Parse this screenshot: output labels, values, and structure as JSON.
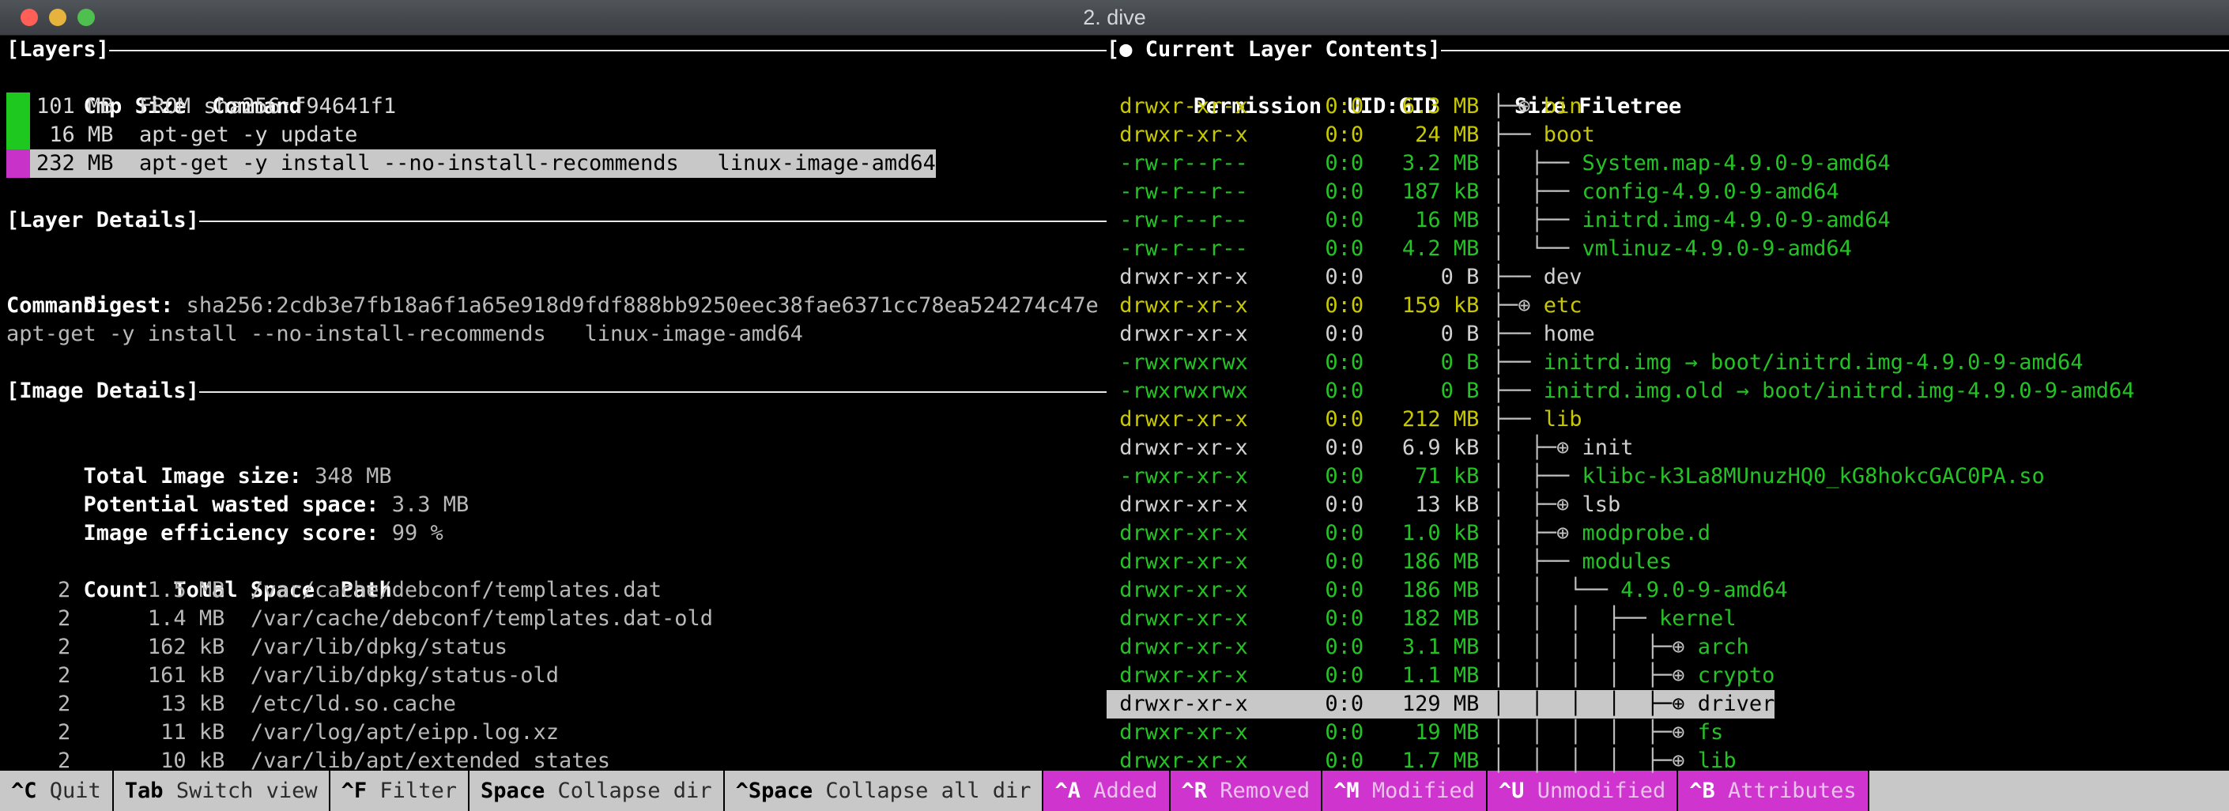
{
  "window": {
    "title": "2. dive",
    "controls": [
      "close-button",
      "minimize-button",
      "zoom-button"
    ]
  },
  "colors": {
    "added": "#25c225",
    "modified": "#c8c800",
    "unmodified": "#d0d0d0",
    "selection_bg": "#c8c8c8",
    "status_pink": "#cf34cf",
    "layer_swatch_green": "#1ec81e",
    "layer_swatch_magenta": "#c832c8",
    "terminal_bg": "#000000"
  },
  "left": {
    "layers_panel": {
      "title": "[Layers]",
      "columns": [
        "Cmp",
        "Size",
        "Command"
      ],
      "rows": [
        {
          "swatch": "green",
          "size": "101 MB",
          "command": "FROM sha256:f94641f1",
          "selected": false
        },
        {
          "swatch": "green",
          "size": " 16 MB",
          "command": "apt-get -y update",
          "selected": false
        },
        {
          "swatch": "magenta",
          "size": "232 MB",
          "command": "apt-get -y install --no-install-recommends   linux-image-amd64",
          "selected": true
        }
      ]
    },
    "layer_details_panel": {
      "title": "[Layer Details]",
      "digest_label": "Digest:",
      "digest_value": "sha256:2cdb3e7fb18a6f1a65e918d9fdf888bb9250eec38fae6371cc78ea524274c47e",
      "command_label": "Command:",
      "command_value": "apt-get -y install --no-install-recommends   linux-image-amd64"
    },
    "image_details_panel": {
      "title": "[Image Details]",
      "total_image_size_label": "Total Image size:",
      "total_image_size_value": "348 MB",
      "potential_wasted_space_label": "Potential wasted space:",
      "potential_wasted_space_value": "3.3 MB",
      "image_efficiency_score_label": "Image efficiency score:",
      "image_efficiency_score_value": "99 %",
      "columns": [
        "Count",
        "Total Space",
        "Path"
      ],
      "rows": [
        {
          "count": "2",
          "total_space": "1.5 MB",
          "path": "/var/cache/debconf/templates.dat"
        },
        {
          "count": "2",
          "total_space": "1.4 MB",
          "path": "/var/cache/debconf/templates.dat-old"
        },
        {
          "count": "2",
          "total_space": "162 kB",
          "path": "/var/lib/dpkg/status"
        },
        {
          "count": "2",
          "total_space": "161 kB",
          "path": "/var/lib/dpkg/status-old"
        },
        {
          "count": "2",
          "total_space": " 13 kB",
          "path": "/etc/ld.so.cache"
        },
        {
          "count": "2",
          "total_space": " 11 kB",
          "path": "/var/log/apt/eipp.log.xz"
        },
        {
          "count": "2",
          "total_space": " 10 kB",
          "path": "/var/lib/apt/extended_states"
        }
      ]
    }
  },
  "right": {
    "title": "[● Current Layer Contents]",
    "columns": [
      "Permission",
      "UID:GID",
      "Size",
      "Filetree"
    ],
    "rows": [
      {
        "permission": "drwxr-xr-x",
        "uid_gid": "0:0",
        "size": "6.3 MB",
        "depth": 0,
        "branch": "tee",
        "collapsed": true,
        "name": "bin",
        "state": "modified",
        "selected": false
      },
      {
        "permission": "drwxr-xr-x",
        "uid_gid": "0:0",
        "size": " 24 MB",
        "depth": 0,
        "branch": "tee",
        "collapsed": false,
        "name": "boot",
        "state": "modified",
        "selected": false
      },
      {
        "permission": "-rw-r--r--",
        "uid_gid": "0:0",
        "size": "3.2 MB",
        "depth": 1,
        "branch": "tee",
        "collapsed": false,
        "name": "System.map-4.9.0-9-amd64",
        "state": "added",
        "selected": false
      },
      {
        "permission": "-rw-r--r--",
        "uid_gid": "0:0",
        "size": "187 kB",
        "depth": 1,
        "branch": "tee",
        "collapsed": false,
        "name": "config-4.9.0-9-amd64",
        "state": "added",
        "selected": false
      },
      {
        "permission": "-rw-r--r--",
        "uid_gid": "0:0",
        "size": " 16 MB",
        "depth": 1,
        "branch": "tee",
        "collapsed": false,
        "name": "initrd.img-4.9.0-9-amd64",
        "state": "added",
        "selected": false
      },
      {
        "permission": "-rw-r--r--",
        "uid_gid": "0:0",
        "size": "4.2 MB",
        "depth": 1,
        "branch": "end",
        "collapsed": false,
        "name": "vmlinuz-4.9.0-9-amd64",
        "state": "added",
        "selected": false
      },
      {
        "permission": "drwxr-xr-x",
        "uid_gid": "0:0",
        "size": "  0 B",
        "depth": 0,
        "branch": "tee",
        "collapsed": false,
        "name": "dev",
        "state": "unmodified",
        "selected": false
      },
      {
        "permission": "drwxr-xr-x",
        "uid_gid": "0:0",
        "size": "159 kB",
        "depth": 0,
        "branch": "tee",
        "collapsed": true,
        "name": "etc",
        "state": "modified",
        "selected": false
      },
      {
        "permission": "drwxr-xr-x",
        "uid_gid": "0:0",
        "size": "  0 B",
        "depth": 0,
        "branch": "tee",
        "collapsed": false,
        "name": "home",
        "state": "unmodified",
        "selected": false
      },
      {
        "permission": "-rwxrwxrwx",
        "uid_gid": "0:0",
        "size": "  0 B",
        "depth": 0,
        "branch": "tee",
        "collapsed": false,
        "name": "initrd.img → boot/initrd.img-4.9.0-9-amd64",
        "state": "added",
        "selected": false
      },
      {
        "permission": "-rwxrwxrwx",
        "uid_gid": "0:0",
        "size": "  0 B",
        "depth": 0,
        "branch": "tee",
        "collapsed": false,
        "name": "initrd.img.old → boot/initrd.img-4.9.0-9-amd64",
        "state": "added",
        "selected": false
      },
      {
        "permission": "drwxr-xr-x",
        "uid_gid": "0:0",
        "size": "212 MB",
        "depth": 0,
        "branch": "tee",
        "collapsed": false,
        "name": "lib",
        "state": "modified",
        "selected": false
      },
      {
        "permission": "drwxr-xr-x",
        "uid_gid": "0:0",
        "size": "6.9 kB",
        "depth": 1,
        "branch": "tee",
        "collapsed": true,
        "name": "init",
        "state": "unmodified",
        "selected": false
      },
      {
        "permission": "-rwxr-xr-x",
        "uid_gid": "0:0",
        "size": " 71 kB",
        "depth": 1,
        "branch": "tee",
        "collapsed": false,
        "name": "klibc-k3La8MUnuzHQ0_kG8hokcGAC0PA.so",
        "state": "added",
        "selected": false
      },
      {
        "permission": "drwxr-xr-x",
        "uid_gid": "0:0",
        "size": " 13 kB",
        "depth": 1,
        "branch": "tee",
        "collapsed": true,
        "name": "lsb",
        "state": "unmodified",
        "selected": false
      },
      {
        "permission": "drwxr-xr-x",
        "uid_gid": "0:0",
        "size": "1.0 kB",
        "depth": 1,
        "branch": "tee",
        "collapsed": true,
        "name": "modprobe.d",
        "state": "added",
        "selected": false
      },
      {
        "permission": "drwxr-xr-x",
        "uid_gid": "0:0",
        "size": "186 MB",
        "depth": 1,
        "branch": "tee",
        "collapsed": false,
        "name": "modules",
        "state": "added",
        "selected": false
      },
      {
        "permission": "drwxr-xr-x",
        "uid_gid": "0:0",
        "size": "186 MB",
        "depth": 2,
        "branch": "end",
        "collapsed": false,
        "name": "4.9.0-9-amd64",
        "state": "added",
        "selected": false
      },
      {
        "permission": "drwxr-xr-x",
        "uid_gid": "0:0",
        "size": "182 MB",
        "depth": 3,
        "branch": "tee",
        "collapsed": false,
        "name": "kernel",
        "state": "added",
        "selected": false
      },
      {
        "permission": "drwxr-xr-x",
        "uid_gid": "0:0",
        "size": "3.1 MB",
        "depth": 4,
        "branch": "tee",
        "collapsed": true,
        "name": "arch",
        "state": "added",
        "selected": false
      },
      {
        "permission": "drwxr-xr-x",
        "uid_gid": "0:0",
        "size": "1.1 MB",
        "depth": 4,
        "branch": "tee",
        "collapsed": true,
        "name": "crypto",
        "state": "added",
        "selected": false
      },
      {
        "permission": "drwxr-xr-x",
        "uid_gid": "0:0",
        "size": "129 MB",
        "depth": 4,
        "branch": "tee",
        "collapsed": true,
        "name": "drivers",
        "state": "added",
        "selected": true
      },
      {
        "permission": "drwxr-xr-x",
        "uid_gid": "0:0",
        "size": " 19 MB",
        "depth": 4,
        "branch": "tee",
        "collapsed": true,
        "name": "fs",
        "state": "added",
        "selected": false
      },
      {
        "permission": "drwxr-xr-x",
        "uid_gid": "0:0",
        "size": "1.7 MB",
        "depth": 4,
        "branch": "tee",
        "collapsed": true,
        "name": "lib",
        "state": "added",
        "selected": false
      }
    ]
  },
  "statusbar": {
    "items": [
      {
        "key": "^C",
        "desc": " Quit",
        "pink": false
      },
      {
        "key": "Tab",
        "desc": " Switch view",
        "pink": false
      },
      {
        "key": "^F",
        "desc": " Filter",
        "pink": false
      },
      {
        "key": "Space",
        "desc": " Collapse dir",
        "pink": false
      },
      {
        "key": "^Space",
        "desc": " Collapse all dir",
        "pink": false
      },
      {
        "key": "^A",
        "desc": " Added",
        "pink": true
      },
      {
        "key": "^R",
        "desc": " Removed",
        "pink": true
      },
      {
        "key": "^M",
        "desc": " Modified",
        "pink": true
      },
      {
        "key": "^U",
        "desc": " Unmodified",
        "pink": true
      },
      {
        "key": "^B",
        "desc": " Attributes",
        "pink": true
      }
    ]
  }
}
